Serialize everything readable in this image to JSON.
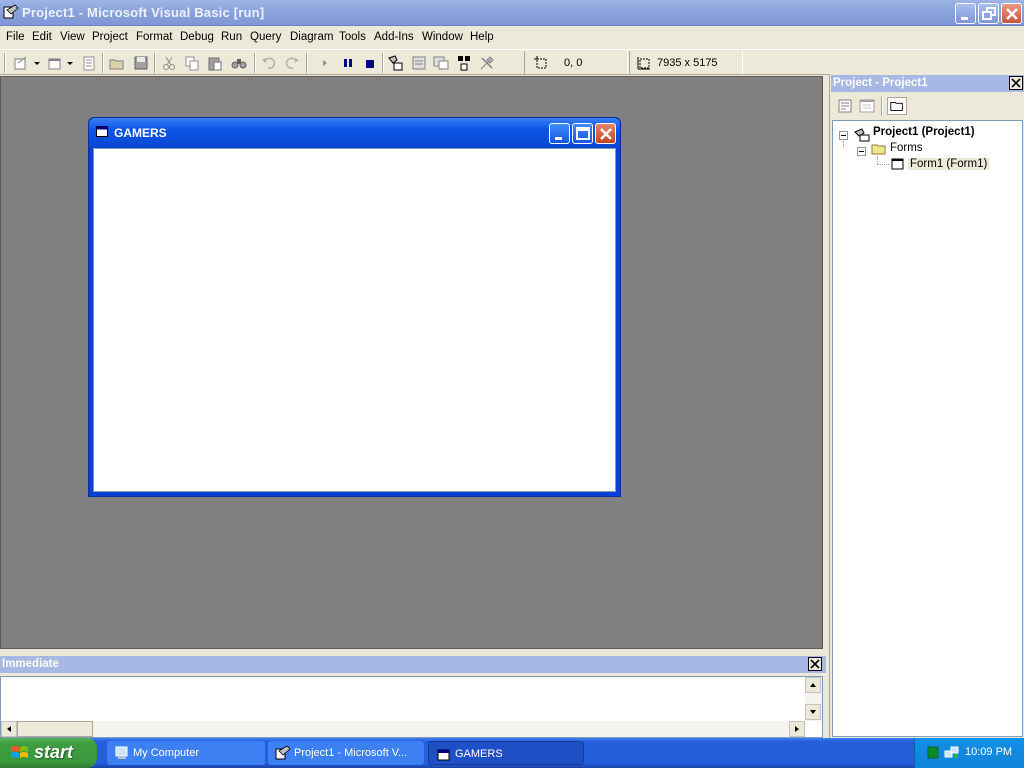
{
  "window": {
    "title": "Project1 - Microsoft Visual Basic [run]"
  },
  "menu": [
    "File",
    "Edit",
    "View",
    "Project",
    "Format",
    "Debug",
    "Run",
    "Query",
    "Diagram",
    "Tools",
    "Add-Ins",
    "Window",
    "Help"
  ],
  "toolbar": {
    "position": "0, 0",
    "size": "7935 x 5175"
  },
  "form": {
    "title": "GAMERS"
  },
  "project_panel": {
    "title": "Project - Project1",
    "tree": {
      "root": "Project1 (Project1)",
      "folder": "Forms",
      "item": "Form1 (Form1)"
    }
  },
  "immediate": {
    "title": "Immediate"
  },
  "taskbar": {
    "start": "start",
    "tasks": [
      "My Computer",
      "Project1 - Microsoft V...",
      "GAMERS"
    ],
    "clock": "10:09 PM"
  },
  "colors": {
    "mdi_background": "#808080",
    "xp_blue": "#0b55e6",
    "panel_title": "#a6b8e3"
  }
}
